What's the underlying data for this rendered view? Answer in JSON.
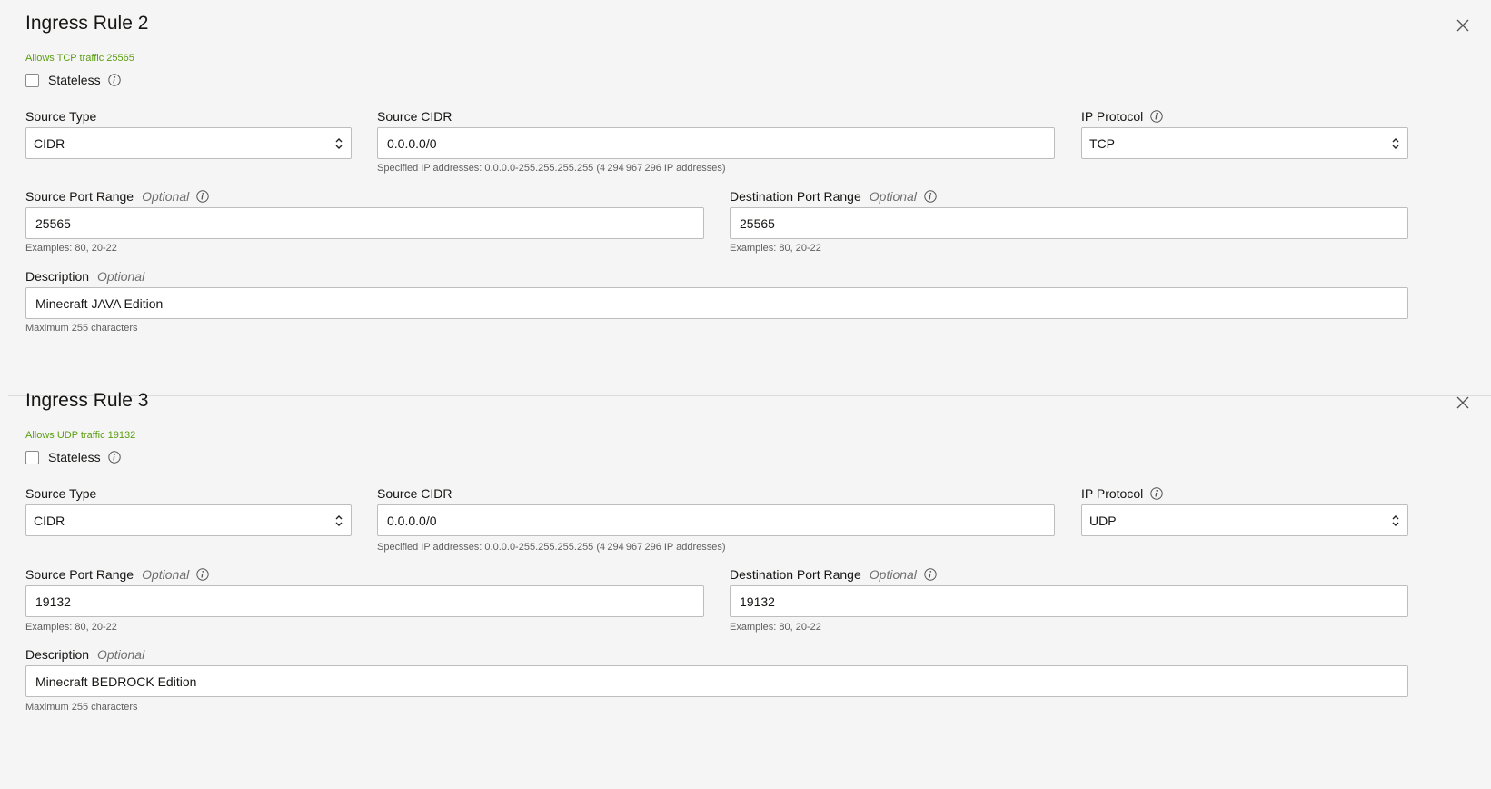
{
  "rules": [
    {
      "title": "Ingress Rule 2",
      "allows_text": "Allows TCP traffic 25565",
      "stateless_label": "Stateless",
      "source_type_label": "Source Type",
      "source_type_value": "CIDR",
      "source_cidr_label": "Source CIDR",
      "source_cidr_value": "0.0.0.0/0",
      "source_cidr_hint": "Specified IP addresses: 0.0.0.0-255.255.255.255 (4 294 967 296 IP addresses)",
      "ip_protocol_label": "IP Protocol",
      "ip_protocol_value": "TCP",
      "source_port_label": "Source Port Range",
      "source_port_value": "25565",
      "source_port_hint": "Examples: 80, 20-22",
      "dest_port_label": "Destination Port Range",
      "dest_port_value": "25565",
      "dest_port_hint": "Examples: 80, 20-22",
      "description_label": "Description",
      "description_value": "Minecraft JAVA Edition",
      "description_hint": "Maximum 255 characters",
      "optional": "Optional"
    },
    {
      "title": "Ingress Rule 3",
      "allows_text": "Allows UDP traffic 19132",
      "stateless_label": "Stateless",
      "source_type_label": "Source Type",
      "source_type_value": "CIDR",
      "source_cidr_label": "Source CIDR",
      "source_cidr_value": "0.0.0.0/0",
      "source_cidr_hint": "Specified IP addresses: 0.0.0.0-255.255.255.255 (4 294 967 296 IP addresses)",
      "ip_protocol_label": "IP Protocol",
      "ip_protocol_value": "UDP",
      "source_port_label": "Source Port Range",
      "source_port_value": "19132",
      "source_port_hint": "Examples: 80, 20-22",
      "dest_port_label": "Destination Port Range",
      "dest_port_value": "19132",
      "dest_port_hint": "Examples: 80, 20-22",
      "description_label": "Description",
      "description_value": "Minecraft BEDROCK Edition",
      "description_hint": "Maximum 255 characters",
      "optional": "Optional"
    }
  ],
  "colors": {
    "allows_text": "#5a9e0f",
    "background": "#f5f5f5"
  },
  "icons": [
    "close-icon",
    "info-icon",
    "select-arrows-icon"
  ]
}
